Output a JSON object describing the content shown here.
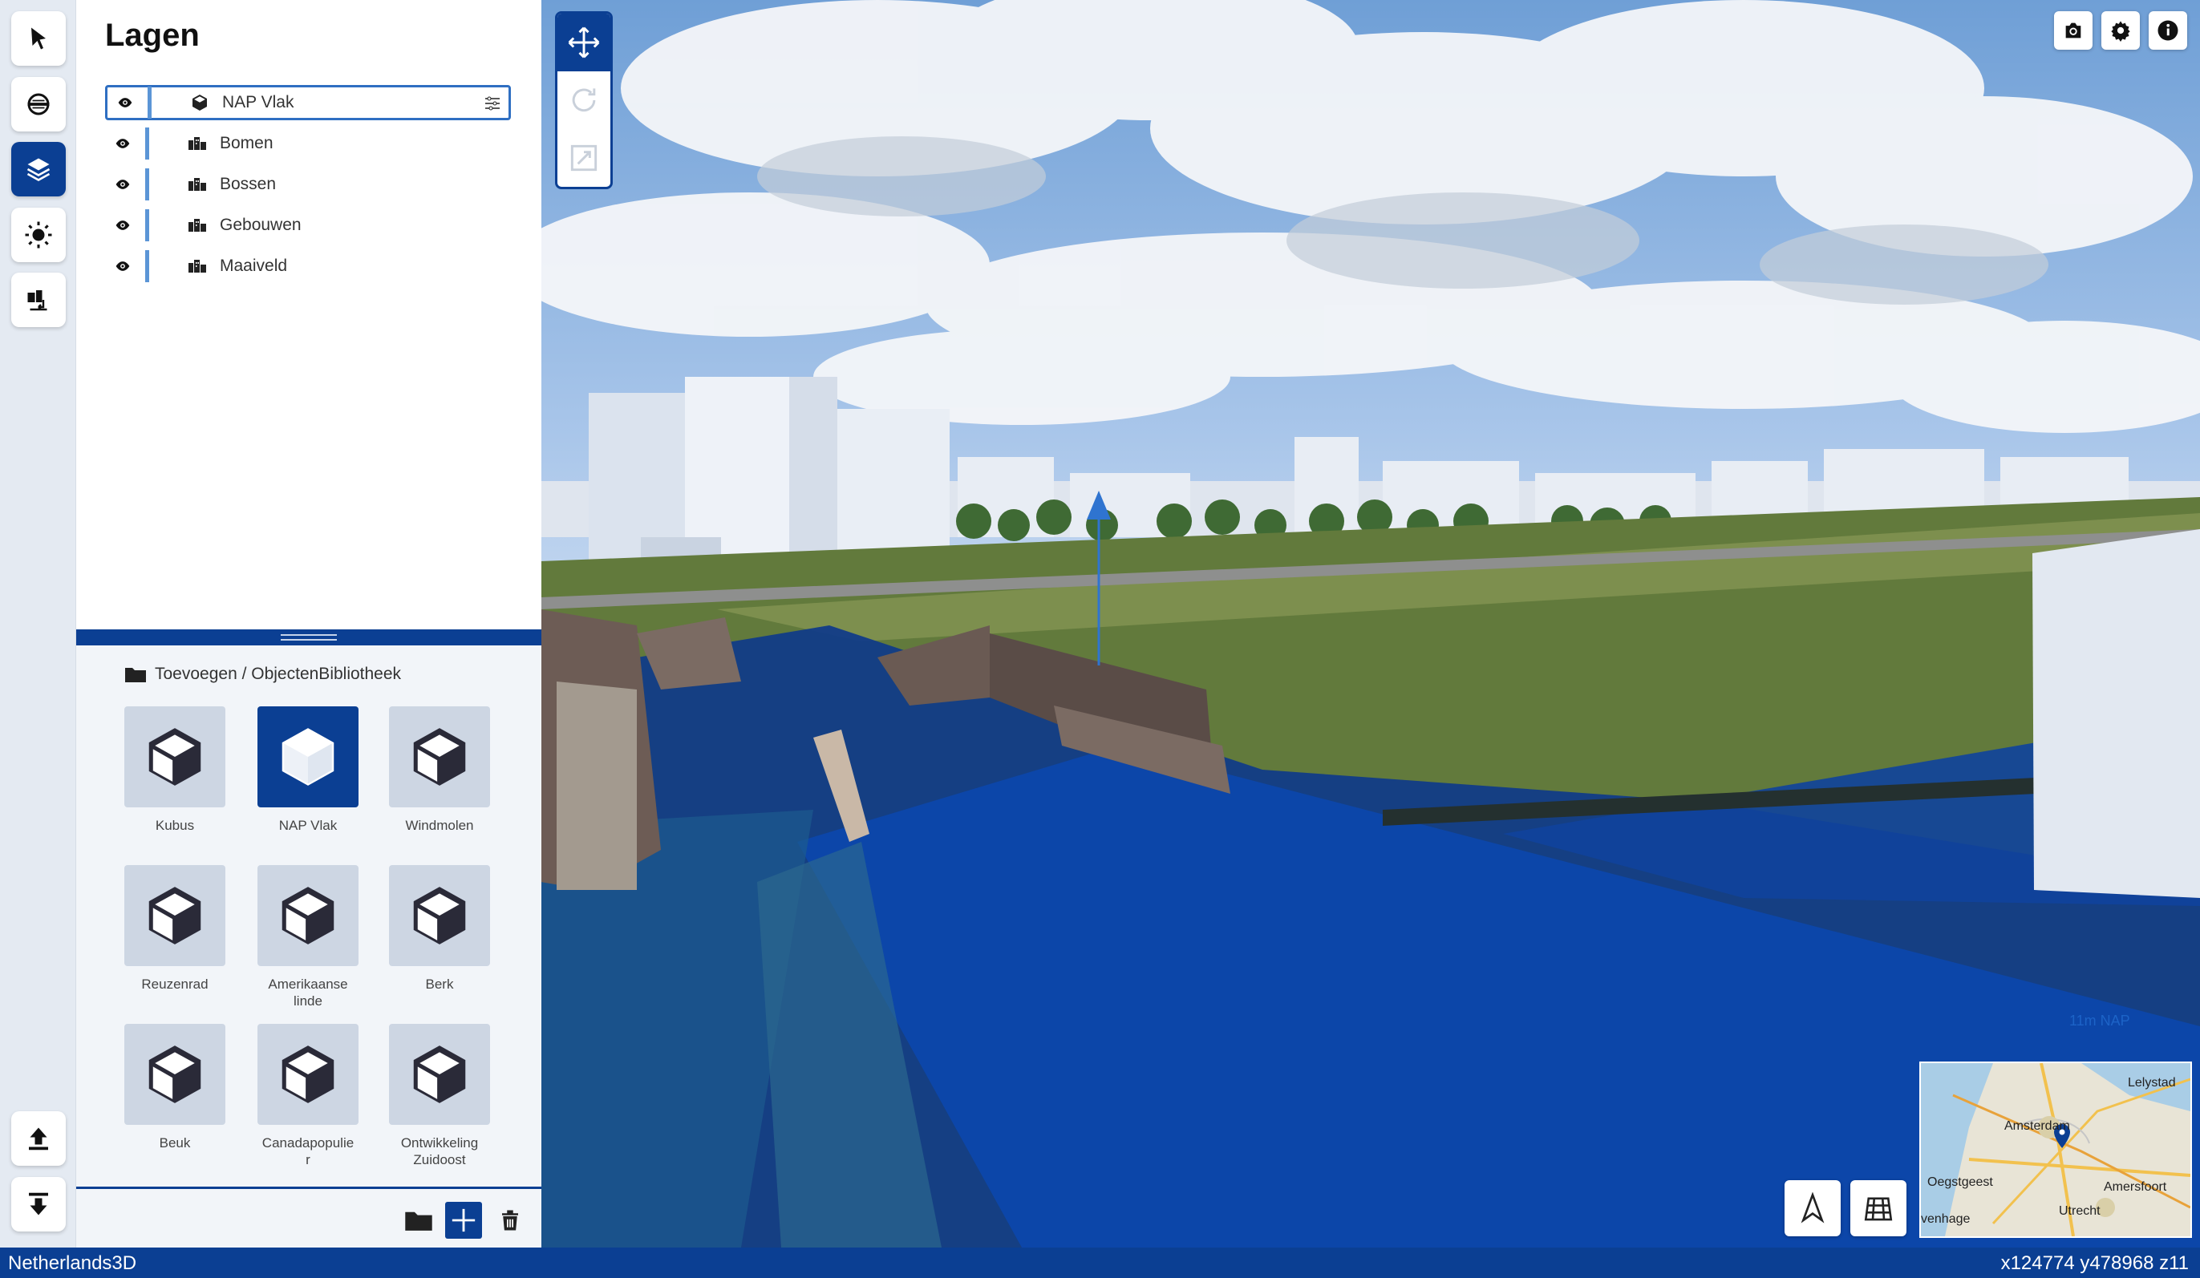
{
  "toolbar": {
    "tools": [
      {
        "name": "select-tool",
        "icon": "cursor-icon"
      },
      {
        "name": "cross-section-tool",
        "icon": "slice-icon"
      },
      {
        "name": "layers-tool",
        "icon": "layers-icon",
        "active": true
      },
      {
        "name": "sun-tool",
        "icon": "sun-icon"
      },
      {
        "name": "import-buildings-tool",
        "icon": "buildings-import-icon"
      }
    ],
    "bottom_tools": [
      {
        "name": "upload-tool",
        "icon": "upload-icon"
      },
      {
        "name": "download-tool",
        "icon": "download-icon"
      }
    ]
  },
  "layers_panel": {
    "title": "Lagen",
    "layers": [
      {
        "label": "NAP Vlak",
        "selected": true,
        "icon": "cube-icon"
      },
      {
        "label": "Bomen",
        "icon": "buildings-icon"
      },
      {
        "label": "Bossen",
        "icon": "buildings-icon"
      },
      {
        "label": "Gebouwen",
        "icon": "buildings-icon"
      },
      {
        "label": "Maaiveld",
        "icon": "buildings-icon"
      }
    ]
  },
  "library": {
    "path": "Toevoegen / ObjectenBibliotheek",
    "items": [
      {
        "label": "Kubus"
      },
      {
        "label": "NAP Vlak",
        "active": true
      },
      {
        "label": "Windmolen"
      },
      {
        "label": "Reuzenrad"
      },
      {
        "label": "Amerikaanse linde"
      },
      {
        "label": "Berk"
      },
      {
        "label": "Beuk"
      },
      {
        "label": "Canadapopulier"
      },
      {
        "label": "Ontwikkeling Zuidoost"
      }
    ]
  },
  "viewport": {
    "nap_label": "11m NAP",
    "minimap_labels": [
      "Lelystad",
      "Amsterdam",
      "Oegstgeest",
      "Amersfoort",
      "Utrecht",
      "venhage"
    ]
  },
  "statusbar": {
    "app_name": "Netherlands3D",
    "coordinates": "x124774 y478968 z11"
  },
  "colors": {
    "accent": "#0b3f93",
    "toolbar_bg": "#e4eaf2",
    "library_bg": "#f2f5f9",
    "tile_bg": "#cdd6e3",
    "water": "#0d3f96",
    "grass": "#5f7a3a"
  }
}
